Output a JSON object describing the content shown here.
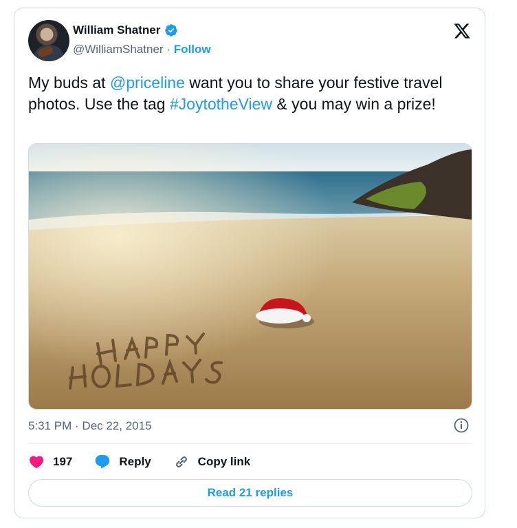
{
  "author": {
    "name": "William Shatner",
    "handle": "@WilliamShatner",
    "separator": "·",
    "follow_label": "Follow"
  },
  "tweet": {
    "text_parts": {
      "p1": "My buds at ",
      "mention": "@priceline",
      "p2": " want you to share your festive travel photos. Use the tag ",
      "hashtag": "#JoytotheView",
      "p3": " & you may win a prize!"
    },
    "photo_text": "HAPPY HOLIDAYS",
    "timestamp": "5:31 PM · Dec 22, 2015"
  },
  "actions": {
    "likes_count": "197",
    "reply_label": "Reply",
    "copy_link_label": "Copy link"
  },
  "read_replies_label": "Read 21 replies",
  "colors": {
    "accent": "#1d9bf0",
    "like": "#f91880",
    "muted": "#536471",
    "border": "#cfd9de"
  },
  "icons": [
    "verified-badge-icon",
    "x-logo-icon",
    "info-icon",
    "heart-icon",
    "reply-icon",
    "link-icon"
  ]
}
